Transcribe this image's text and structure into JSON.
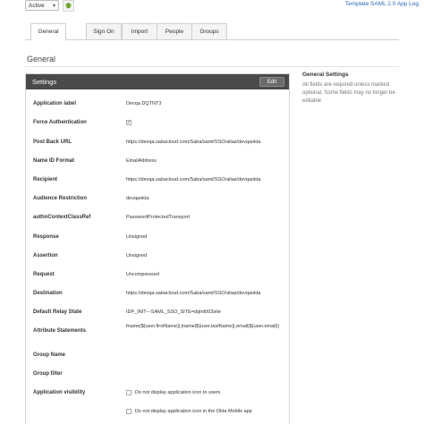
{
  "topbar": {
    "status_value": "Active",
    "app_log_link": "Template SAML 2.0 App Log"
  },
  "tabs": [
    {
      "label": "General",
      "active": true
    },
    {
      "label": "Sign On",
      "active": false
    },
    {
      "label": "Import",
      "active": false
    },
    {
      "label": "People",
      "active": false
    },
    {
      "label": "Groups",
      "active": false
    }
  ],
  "section_title": "General",
  "settings": {
    "title": "Settings",
    "edit_label": "Edit",
    "fields": {
      "application_label": {
        "label": "Application label",
        "value": "Devqa DQTNT3"
      },
      "force_authentication": {
        "label": "Force Authentication",
        "checked": true
      },
      "post_back_url": {
        "label": "Post Back URL",
        "value": "https://devqa.sabacloud.com/Saba/saml/SSO/alias/devqaokta"
      },
      "name_id_format": {
        "label": "Name ID Format",
        "value": "EmailAddress"
      },
      "recipient": {
        "label": "Recipient",
        "value": "https://devqa.sabacloud.com/Saba/saml/SSO/alias/devqaokta"
      },
      "audience_restriction": {
        "label": "Audience Restriction",
        "value": "devqaokta"
      },
      "authn_context_class_ref": {
        "label": "authnContextClassRef",
        "value": "PasswordProtectedTransport"
      },
      "response": {
        "label": "Response",
        "value": "Unsigned"
      },
      "assertion": {
        "label": "Assertion",
        "value": "Unsigned"
      },
      "request": {
        "label": "Request",
        "value": "Uncompressed"
      },
      "destination": {
        "label": "Destination",
        "value": "https://devqa.sabacloud.com/Saba/saml/SSO/alias/devqaokta"
      },
      "default_relay_state": {
        "label": "Default Relay State",
        "value": "IDP_INIT---SAML_SSO_SITE=dqtnt003site"
      },
      "attribute_statements": {
        "label": "Attribute Statements",
        "value": "fname|${user.firstName}|,lname|${user.lastName}|,email|${user.email}|"
      },
      "group_name": {
        "label": "Group Name",
        "value": ""
      },
      "group_filter": {
        "label": "Group filter",
        "value": ""
      },
      "application_visibility": {
        "label": "Application visibility",
        "options": [
          {
            "label": "Do not display application icon to users",
            "checked": false
          },
          {
            "label": "Do not display application icon in the Okta Mobile app",
            "checked": false
          }
        ]
      }
    }
  },
  "help": {
    "title": "General Settings",
    "text": "All fields are required unless marked optional. Some fields may no longer be editable"
  }
}
